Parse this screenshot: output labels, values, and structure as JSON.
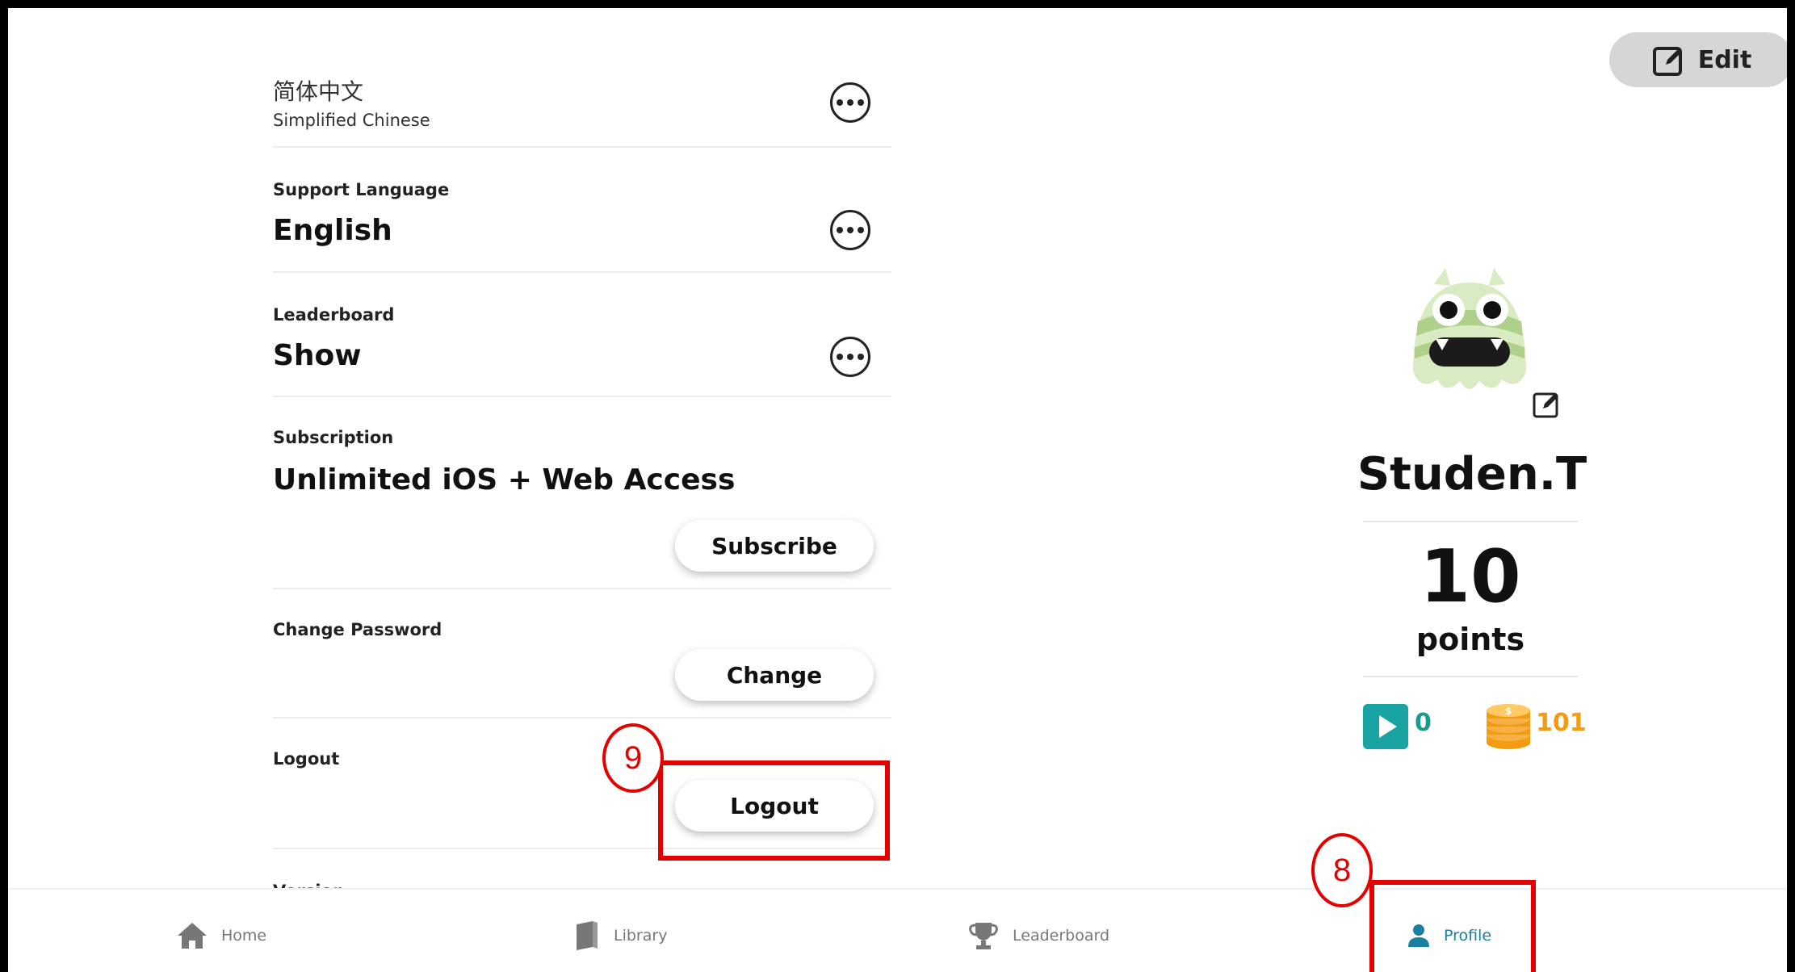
{
  "header": {
    "edit_label": "Edit"
  },
  "settings": {
    "language": {
      "value_partial": "简体中文",
      "sub": "Simplified Chinese"
    },
    "support_language": {
      "label": "Support Language",
      "value": "English"
    },
    "leaderboard": {
      "label": "Leaderboard",
      "value": "Show"
    },
    "subscription": {
      "label": "Subscription",
      "value": "Unlimited iOS + Web Access",
      "button": "Subscribe"
    },
    "change_password": {
      "label": "Change Password",
      "button": "Change"
    },
    "logout": {
      "label": "Logout",
      "button": "Logout"
    },
    "version": {
      "label_partial": "Version"
    }
  },
  "profile": {
    "username": "Studen.T",
    "points_value": "10",
    "points_label": "points",
    "videos_count": "0",
    "coins_count": "101"
  },
  "nav": {
    "home": "Home",
    "library": "Library",
    "leaderboard": "Leaderboard",
    "profile": "Profile"
  },
  "annotations": {
    "circle_8": "8",
    "circle_9": "9"
  },
  "colors": {
    "accent": "#1a7fa0",
    "annotation": "#e50000",
    "coins": "#f39c12",
    "video": "#1aa3a3"
  },
  "icons": [
    "pencil-square-icon",
    "more-icon",
    "home-icon",
    "book-icon",
    "trophy-icon",
    "person-icon",
    "play-icon",
    "coin-stack-icon"
  ]
}
